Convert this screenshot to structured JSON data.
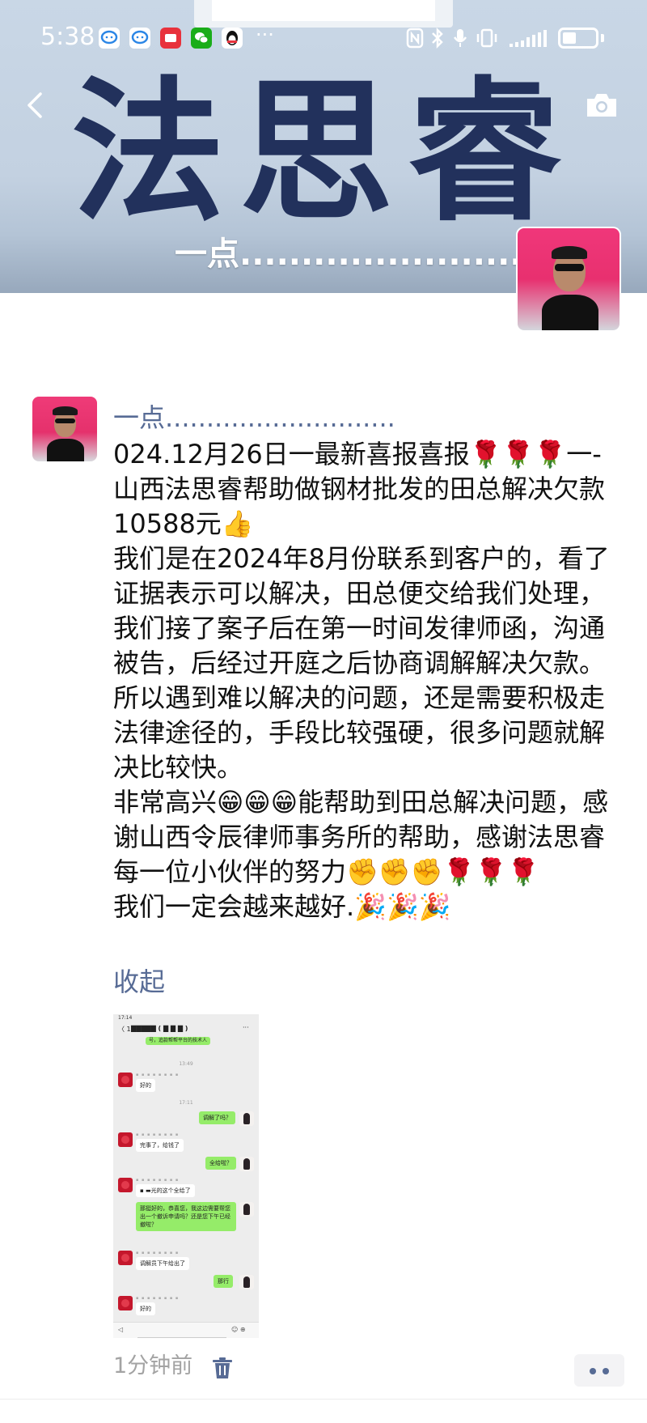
{
  "status_bar": {
    "time": "5:38",
    "more": "···",
    "apps": [
      {
        "icon": "qq-chat-icon",
        "color": "#ffffff"
      },
      {
        "icon": "qq-chat-icon",
        "color": "#ffffff"
      },
      {
        "icon": "red-app-icon",
        "color": "#e8323c"
      },
      {
        "icon": "wechat-icon",
        "color": "#1aad19"
      },
      {
        "icon": "qq-penguin-icon",
        "color": "#ffffff"
      }
    ],
    "indicators": [
      "nfc-icon",
      "bluetooth-icon",
      "microphone-icon",
      "vibrate-icon",
      "signal-icon",
      "battery-icon"
    ]
  },
  "cover": {
    "title": "法思睿",
    "name": "一点.........................."
  },
  "post": {
    "author": "一点............................",
    "paragraphs": [
      "024.12月26日一最新喜报喜报🌹🌹🌹一-山西法思睿帮助做钢材批发的田总解决欠款10588元👍",
      "我们是在2024年8月份联系到客户的，看了证据表示可以解决，田总便交给我们处理，我们接了案子后在第一时间发律师函，沟通被告，后经过开庭之后协商调解解决欠款。",
      "所以遇到难以解决的问题，还是需要积极走法律途径的，手段比较强硬，很多问题就解决比较快。",
      "非常高兴😁😁😁能帮助到田总解决问题，感谢山西令辰律师事务所的帮助，感谢法思睿每一位小伙伴的努力✊✊✊🌹🌹🌹",
      "我们一定会越来越好.🎉🎉🎉"
    ],
    "collapse_label": "收起",
    "time_ago": "1分钟前"
  },
  "thumbnail": {
    "status_time": "17:14",
    "header_back": "〈 1",
    "header_title": "▇▇▇▇▇ ( ▇ ▇ ▇ )",
    "header_dots": "···",
    "top_bubble": "号，追款帮帮平台的技术人",
    "messages": [
      {
        "type": "time",
        "text": "13:49"
      },
      {
        "type": "in",
        "text": "好的"
      },
      {
        "type": "time",
        "text": "17:11"
      },
      {
        "type": "out",
        "text": "调解了吗？"
      },
      {
        "type": "in",
        "text": "完事了，给钱了"
      },
      {
        "type": "out",
        "text": "全给啦？"
      },
      {
        "type": "in",
        "text": "▪ ▬光的这个全给了"
      },
      {
        "type": "out",
        "text": "那挺好的，恭喜您，我这边需要帮您出一个撤诉申请吗？还是您下午已经撤啦？"
      },
      {
        "type": "in",
        "text": "调解员下午给出了"
      },
      {
        "type": "out",
        "text": "那行"
      },
      {
        "type": "in",
        "text": "好的"
      }
    ],
    "input_left": "◁",
    "input_right": "☺ ⊕"
  },
  "colors": {
    "link": "#576b95",
    "cover_title": "#22315c",
    "bubble_out": "#95ec69"
  }
}
